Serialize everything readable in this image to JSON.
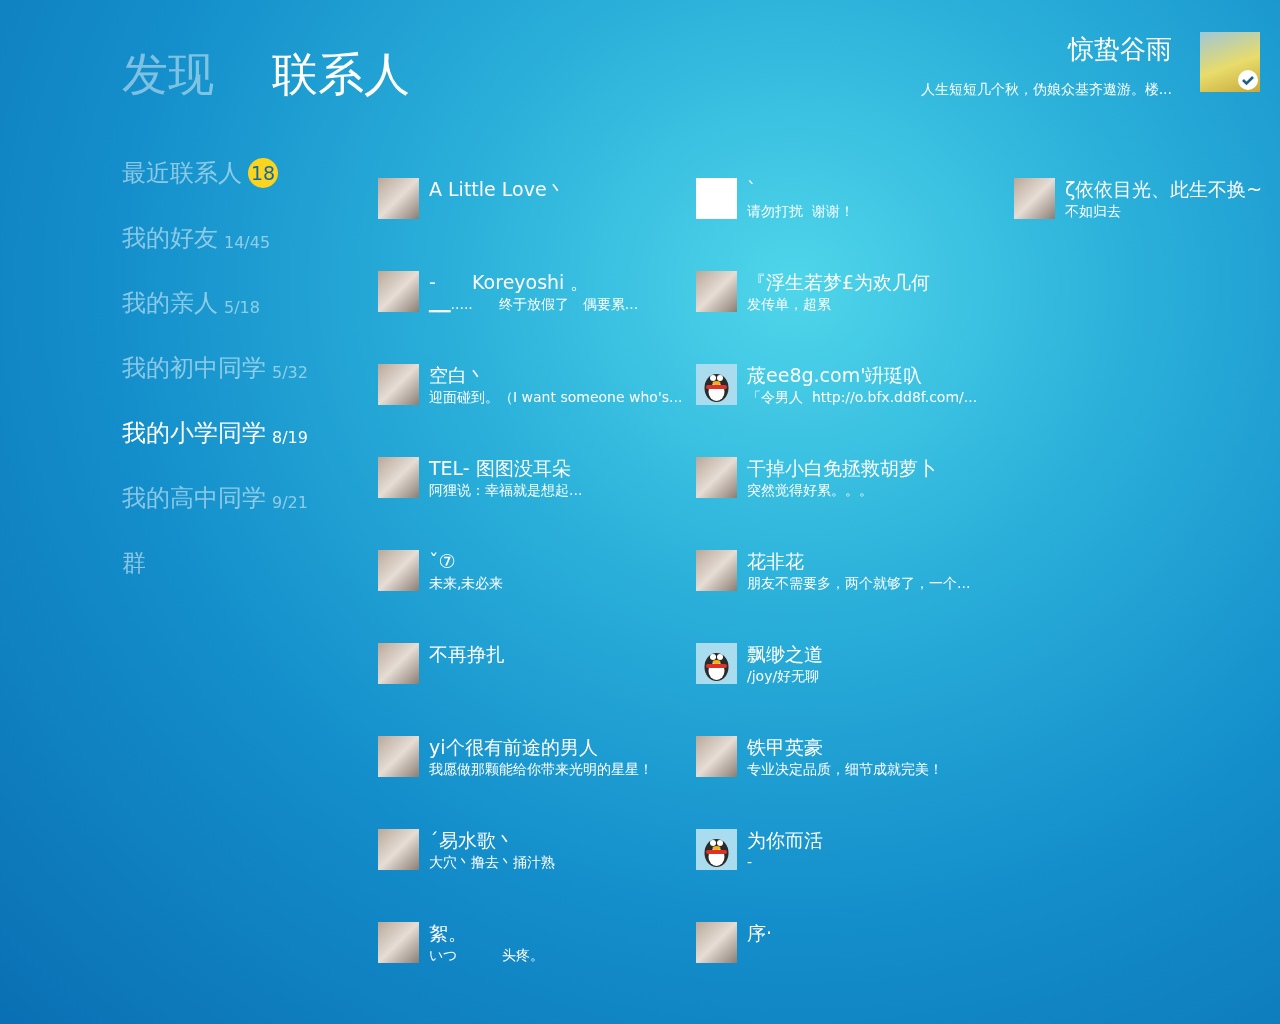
{
  "header_tabs": [
    {
      "label": "发现",
      "selected": false
    },
    {
      "label": "联系人",
      "selected": true
    }
  ],
  "profile": {
    "name": "惊蛰谷雨",
    "signature": "人生短短几个秋，伪娘众基齐遨游。楼..."
  },
  "groups": [
    {
      "name": "最近联系人",
      "badge": "18",
      "selected": false
    },
    {
      "name": "我的好友",
      "count": "14/45",
      "selected": false
    },
    {
      "name": "我的亲人",
      "count": "5/18",
      "selected": false
    },
    {
      "name": "我的初中同学",
      "count": "5/32",
      "selected": false
    },
    {
      "name": "我的小学同学",
      "count": "8/19",
      "selected": true
    },
    {
      "name": "我的高中同学",
      "count": "9/21",
      "selected": false
    },
    {
      "name": "群",
      "selected": false
    }
  ],
  "contact_rows": [
    [
      {
        "name": "A Little Love丶",
        "kind": "photo"
      },
      {
        "name": "`",
        "status": "请勿打扰  谢谢！",
        "kind": "blank"
      },
      {
        "name": "ζ依依目光、此生不换~",
        "status": "不如归去",
        "kind": "photo"
      }
    ],
    [
      {
        "name": "-      Koreyoshi 。",
        "status": "▁▁.....      终于放假了   偶要累...",
        "kind": "photo"
      },
      {
        "name": "『浮生若梦£为欢几何",
        "status": "发传单，超累",
        "kind": "photo"
      }
    ],
    [
      {
        "name": "空白丶",
        "status": "迎面碰到。（I want someone who's...",
        "kind": "photo"
      },
      {
        "name": "荿ee8g.com'竔珽叺",
        "status": "「令男人  http://o.bfx.dd8f.com/...",
        "kind": "penguin"
      }
    ],
    [
      {
        "name": "TEL- 图图没耳朵",
        "status": "阿狸说：幸福就是想起...",
        "kind": "photo"
      },
      {
        "name": "干掉小白免拯救胡萝卜",
        "status": "突然觉得好累。。。",
        "kind": "photo"
      }
    ],
    [
      {
        "name": "ˇ⑦",
        "status": "未来,未必来",
        "kind": "photo"
      },
      {
        "name": "花非花",
        "status": "朋友不需要多，两个就够了，一个...",
        "kind": "photo"
      }
    ],
    [
      {
        "name": "不再挣扎",
        "kind": "photo"
      },
      {
        "name": "飘缈之道",
        "status": "/joy/好无聊",
        "kind": "penguin"
      }
    ],
    [
      {
        "name": "yi个很有前途的男人",
        "status": "我愿做那颗能给你带来光明的星星！",
        "kind": "photo"
      },
      {
        "name": "铁甲英豪",
        "status": "专业决定品质，细节成就完美！",
        "kind": "photo"
      }
    ],
    [
      {
        "name": "´易水歌丶",
        "status": "大穴丶撸去丶捅汁熟",
        "kind": "photo"
      },
      {
        "name": "为你而活",
        "status": "-",
        "kind": "penguin"
      }
    ],
    [
      {
        "name": "絮。",
        "status": "いつ          头疼。",
        "kind": "photo"
      },
      {
        "name": "序·",
        "kind": "photo"
      }
    ]
  ]
}
